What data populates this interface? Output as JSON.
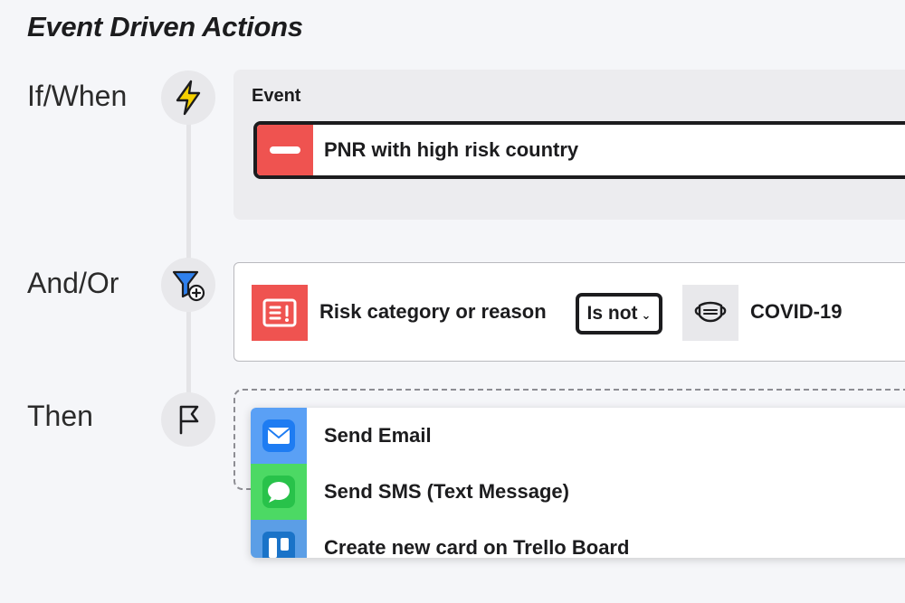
{
  "page_title": "Event Driven Actions",
  "steps": {
    "if_when": "If/When",
    "and_or": "And/Or",
    "then": "Then"
  },
  "event": {
    "label": "Event",
    "selected": "PNR with high risk country"
  },
  "condition": {
    "field": "Risk category or reason",
    "operator": "Is not",
    "value": "COVID-19"
  },
  "actions": [
    {
      "label": "Send Email",
      "icon": "mail-icon",
      "color": "#3d8ef7"
    },
    {
      "label": "Send SMS (Text Message)",
      "icon": "message-bubble-icon",
      "color": "#34c759"
    },
    {
      "label": "Create new card on Trello Board",
      "icon": "trello-icon",
      "color": "#1a73c8"
    }
  ],
  "colors": {
    "accent_red": "#ef5350",
    "bolt_yellow": "#f5d000",
    "filter_blue": "#2f80ed"
  }
}
